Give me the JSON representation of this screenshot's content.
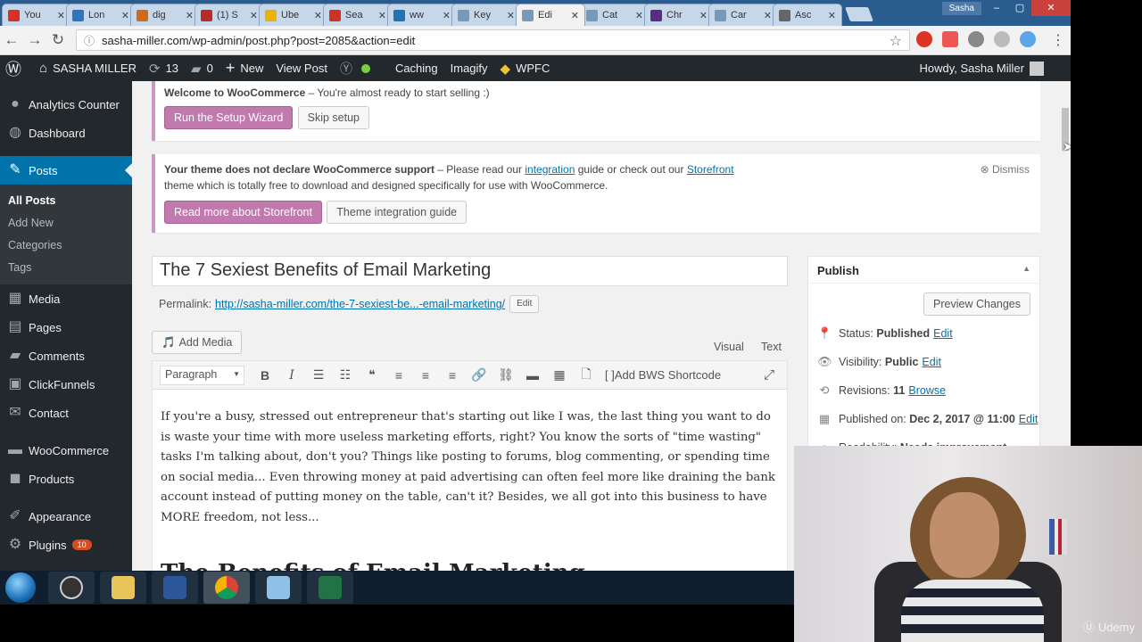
{
  "browser": {
    "tabs": [
      {
        "title": "You",
        "color": "#d93025",
        "icon": "gmail-icon"
      },
      {
        "title": "Lon",
        "color": "#2f74c0",
        "icon": "twitter-icon"
      },
      {
        "title": "dig",
        "color": "#d06a1a",
        "icon": "circle-icon"
      },
      {
        "title": "(1) S",
        "color": "#b92b27",
        "icon": "quora-icon"
      },
      {
        "title": "Ube",
        "color": "#e8b400",
        "icon": "uber-icon"
      },
      {
        "title": "Sea",
        "color": "#cc3322",
        "icon": "search-icon"
      },
      {
        "title": "ww",
        "color": "#2273b6",
        "icon": "wordpress-icon"
      },
      {
        "title": "Key",
        "color": "#7799bb",
        "icon": "page-icon"
      },
      {
        "title": "Edi",
        "color": "#7799bb",
        "icon": "page-icon",
        "active": true
      },
      {
        "title": "Cat",
        "color": "#7799bb",
        "icon": "page-icon"
      },
      {
        "title": "Chr",
        "color": "#5a2c82",
        "icon": "chrome-store-icon"
      },
      {
        "title": "Car",
        "color": "#7799bb",
        "icon": "page-icon"
      },
      {
        "title": "Asc",
        "color": "#666666",
        "icon": "a-icon"
      }
    ],
    "user_badge": "Sasha",
    "url": "sasha-miller.com/wp-admin/post.php?post=2085&action=edit"
  },
  "adminbar": {
    "site_name": "SASHA MILLER",
    "updates_count": "13",
    "comments_count": "0",
    "new_label": "New",
    "view_post_label": "View Post",
    "caching_label": "Caching",
    "imagify_label": "Imagify",
    "wpfc_label": "WPFC",
    "howdy": "Howdy, Sasha Miller"
  },
  "sidebar": {
    "items": [
      {
        "label": "Analytics Counter",
        "icon": "analytics-icon"
      },
      {
        "label": "Dashboard",
        "icon": "dashboard-icon"
      },
      {
        "label": "Posts",
        "icon": "pin-icon",
        "current": true
      },
      {
        "label": "Media",
        "icon": "media-icon"
      },
      {
        "label": "Pages",
        "icon": "pages-icon"
      },
      {
        "label": "Comments",
        "icon": "comments-icon"
      },
      {
        "label": "ClickFunnels",
        "icon": "clickfunnels-icon"
      },
      {
        "label": "Contact",
        "icon": "mail-icon"
      },
      {
        "label": "WooCommerce",
        "icon": "woo-icon"
      },
      {
        "label": "Products",
        "icon": "products-icon"
      },
      {
        "label": "Appearance",
        "icon": "appearance-icon"
      },
      {
        "label": "Plugins",
        "icon": "plugins-icon",
        "badge": "10"
      }
    ],
    "posts_sub": [
      "All Posts",
      "Add New",
      "Categories",
      "Tags"
    ]
  },
  "notice1": {
    "bold": "Welcome to WooCommerce",
    "rest": " – You're almost ready to start selling :)",
    "primary_btn": "Run the Setup Wizard",
    "secondary_btn": "Skip setup"
  },
  "notice2": {
    "bold": "Your theme does not declare WooCommerce support",
    "text1": " – Please read our ",
    "link1": "integration",
    "text2": " guide or check out our ",
    "link2": "Storefront",
    "line2": "theme which is totally free to download and designed specifically for use with WooCommerce.",
    "dismiss": "Dismiss",
    "primary_btn": "Read more about Storefront",
    "secondary_btn": "Theme integration guide"
  },
  "post": {
    "title": "The 7 Sexiest Benefits of Email Marketing",
    "permalink_label": "Permalink:",
    "permalink_url": "http://sasha-miller.com/the-7-sexiest-be...-email-marketing/",
    "permalink_edit": "Edit",
    "add_media": "Add Media",
    "tab_visual": "Visual",
    "tab_text": "Text",
    "format_select": "Paragraph",
    "bws_shortcode": "Add BWS Shortcode",
    "body": "If you're a busy, stressed out entrepreneur that's starting out like I was, the last thing you want to do is waste your time with more useless marketing efforts, right? You know the sorts of \"time wasting\" tasks I'm talking about, don't you? Things like posting to forums, blog commenting, or spending time on social media... Even throwing money at paid advertising can often feel more like draining the bank account instead of putting money on the table, can't it? Besides, we all got into this business to have MORE freedom, not less...",
    "heading": "The Benefits of Email Marketing"
  },
  "publish": {
    "title": "Publish",
    "preview_btn": "Preview Changes",
    "status_label": "Status:",
    "status_value": "Published",
    "visibility_label": "Visibility:",
    "visibility_value": "Public",
    "revisions_label": "Revisions:",
    "revisions_value": "11",
    "browse": "Browse",
    "published_label": "Published on:",
    "published_value": "Dec 2, 2017 @ 11:00",
    "edit": "Edit",
    "readability_label": "Readability:",
    "readability_value": "Needs improvement"
  },
  "watermark": "Udemy",
  "colors": {
    "wp_dark": "#23282d",
    "wp_blue": "#0073aa",
    "woo_purple": "#c07aad"
  }
}
